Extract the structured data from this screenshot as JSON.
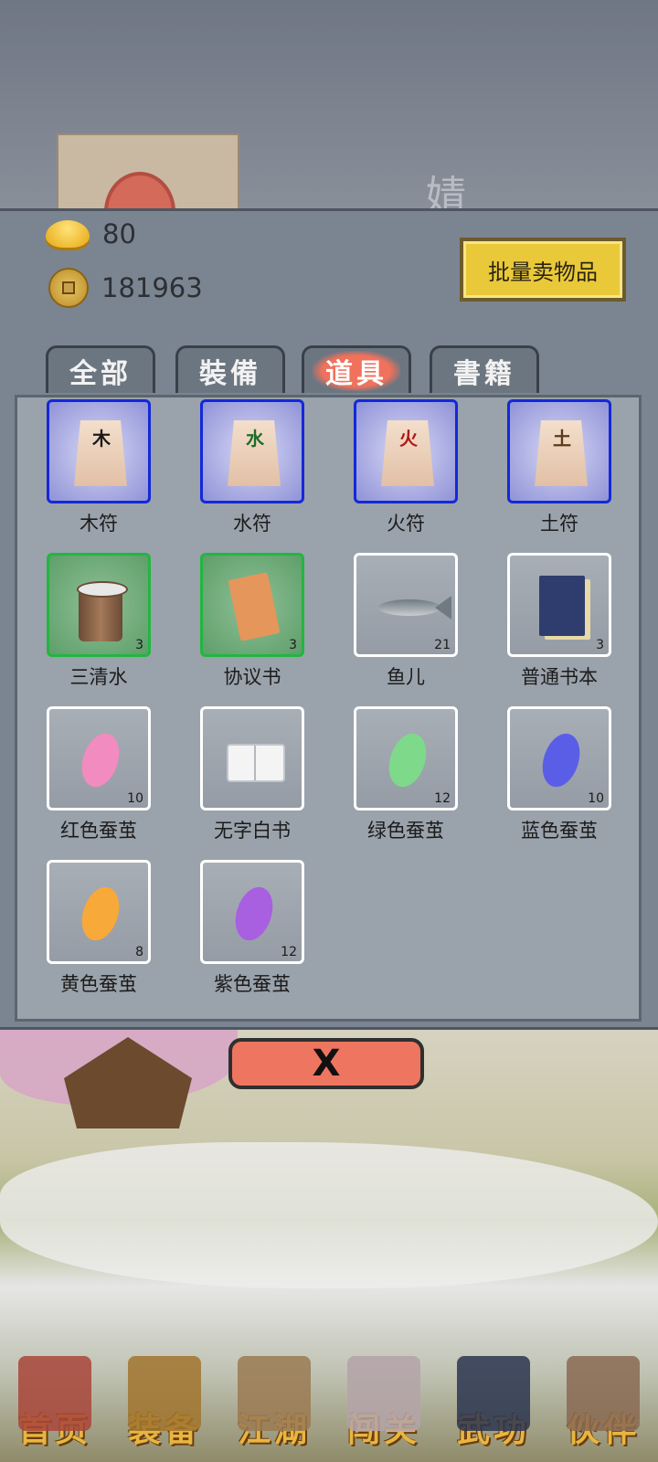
{
  "background": {
    "character_name_glyph": "婧"
  },
  "resources": {
    "ingot": "80",
    "coins": "181963"
  },
  "sell_button": "批量卖物品",
  "tabs": [
    {
      "label": "全部",
      "active": false
    },
    {
      "label": "裝備",
      "active": false
    },
    {
      "label": "道具",
      "active": true
    },
    {
      "label": "書籍",
      "active": false
    }
  ],
  "items": [
    {
      "name": "木符",
      "glyph": "木",
      "glyph_color": "#1a1a1a",
      "quantity": "",
      "rarity": "blue",
      "icon": "wood-talisman-icon"
    },
    {
      "name": "水符",
      "glyph": "水",
      "glyph_color": "#1f6b2a",
      "quantity": "",
      "rarity": "blue",
      "icon": "water-talisman-icon"
    },
    {
      "name": "火符",
      "glyph": "火",
      "glyph_color": "#b01818",
      "quantity": "",
      "rarity": "blue",
      "icon": "fire-talisman-icon"
    },
    {
      "name": "土符",
      "glyph": "土",
      "glyph_color": "#5a3a1a",
      "quantity": "",
      "rarity": "blue",
      "icon": "earth-talisman-icon"
    },
    {
      "name": "三清水",
      "quantity": "3",
      "rarity": "green",
      "icon": "water-bucket-icon"
    },
    {
      "name": "协议书",
      "quantity": "3",
      "rarity": "green",
      "icon": "contract-scroll-icon"
    },
    {
      "name": "鱼儿",
      "quantity": "21",
      "rarity": "white",
      "icon": "fish-icon"
    },
    {
      "name": "普通书本",
      "quantity": "3",
      "rarity": "white",
      "icon": "book-icon"
    },
    {
      "name": "红色蚕茧",
      "quantity": "10",
      "rarity": "white",
      "icon": "cocoon-icon",
      "color": "#f28bc0"
    },
    {
      "name": "无字白书",
      "quantity": "",
      "rarity": "white",
      "icon": "open-book-icon"
    },
    {
      "name": "绿色蚕茧",
      "quantity": "12",
      "rarity": "white",
      "icon": "cocoon-icon",
      "color": "#7fd98a"
    },
    {
      "name": "蓝色蚕茧",
      "quantity": "10",
      "rarity": "white",
      "icon": "cocoon-icon",
      "color": "#5a5ee6"
    },
    {
      "name": "黄色蚕茧",
      "quantity": "8",
      "rarity": "white",
      "icon": "cocoon-icon",
      "color": "#f7a93a"
    },
    {
      "name": "紫色蚕茧",
      "quantity": "12",
      "rarity": "white",
      "icon": "cocoon-icon",
      "color": "#a85fe0"
    }
  ],
  "close_button": "X",
  "nav": [
    {
      "label": "首页",
      "icon": "home-pavilion-icon",
      "pic_color": "#a8453a"
    },
    {
      "label": "装备",
      "icon": "armor-icon",
      "pic_color": "#a0742e"
    },
    {
      "label": "江湖",
      "icon": "scroll-map-icon",
      "pic_color": "#9a7a52"
    },
    {
      "label": "闯关",
      "icon": "crossed-swords-icon",
      "pic_color": "#b4a3a8"
    },
    {
      "label": "武功",
      "icon": "martial-book-icon",
      "pic_color": "#2c3550"
    },
    {
      "label": "伙伴",
      "icon": "partners-icon",
      "pic_color": "#8a6a52"
    }
  ]
}
